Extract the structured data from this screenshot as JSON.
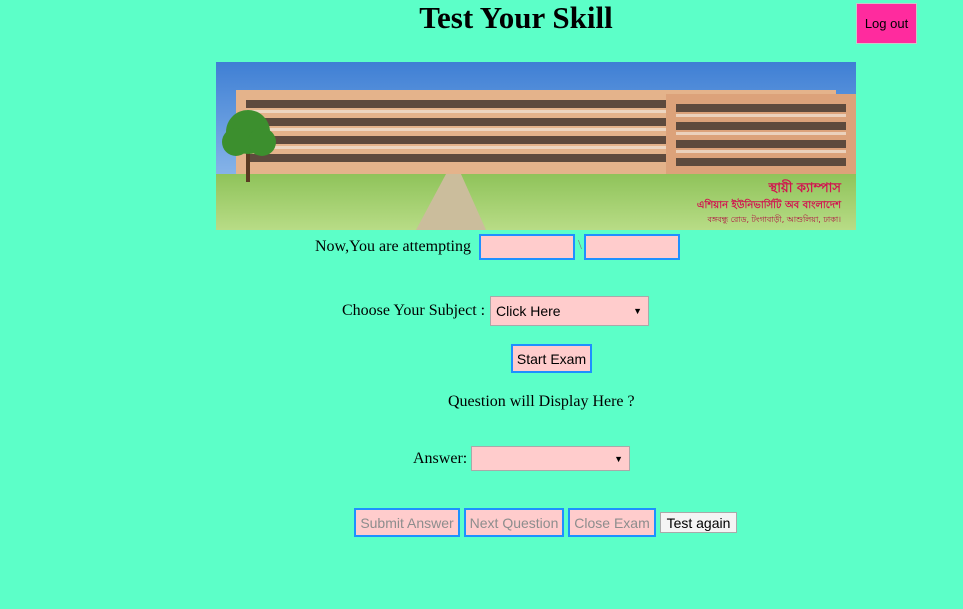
{
  "header": {
    "title": "Test Your Skill",
    "logout_label": "Log out"
  },
  "banner": {
    "caption_line1": "স্থায়ী ক্যাম্পাস",
    "caption_line2": "এশিয়ান ইউনিভার্সিটি অব বাংলাদেশ",
    "caption_line3": "বঙ্গবন্ধু রোড, টংগাবাড়ী, আশুলিয়া, ঢাকা।"
  },
  "attempt": {
    "label": "Now,You are attempting",
    "separator": "\\",
    "current_value": "",
    "total_value": ""
  },
  "subject": {
    "label": "Choose Your Subject :",
    "selected": "Click Here"
  },
  "start_button": "Start Exam",
  "question_text": "Question will Display Here ?",
  "answer": {
    "label": "Answer:",
    "selected": ""
  },
  "actions": {
    "submit": "Submit Answer",
    "next": "Next Question",
    "close": "Close Exam",
    "again": "Test again"
  },
  "colors": {
    "background": "#5cffc8",
    "logout": "#ff2b9e",
    "field_bg": "#ffcccc",
    "field_border": "#1e90ff"
  }
}
